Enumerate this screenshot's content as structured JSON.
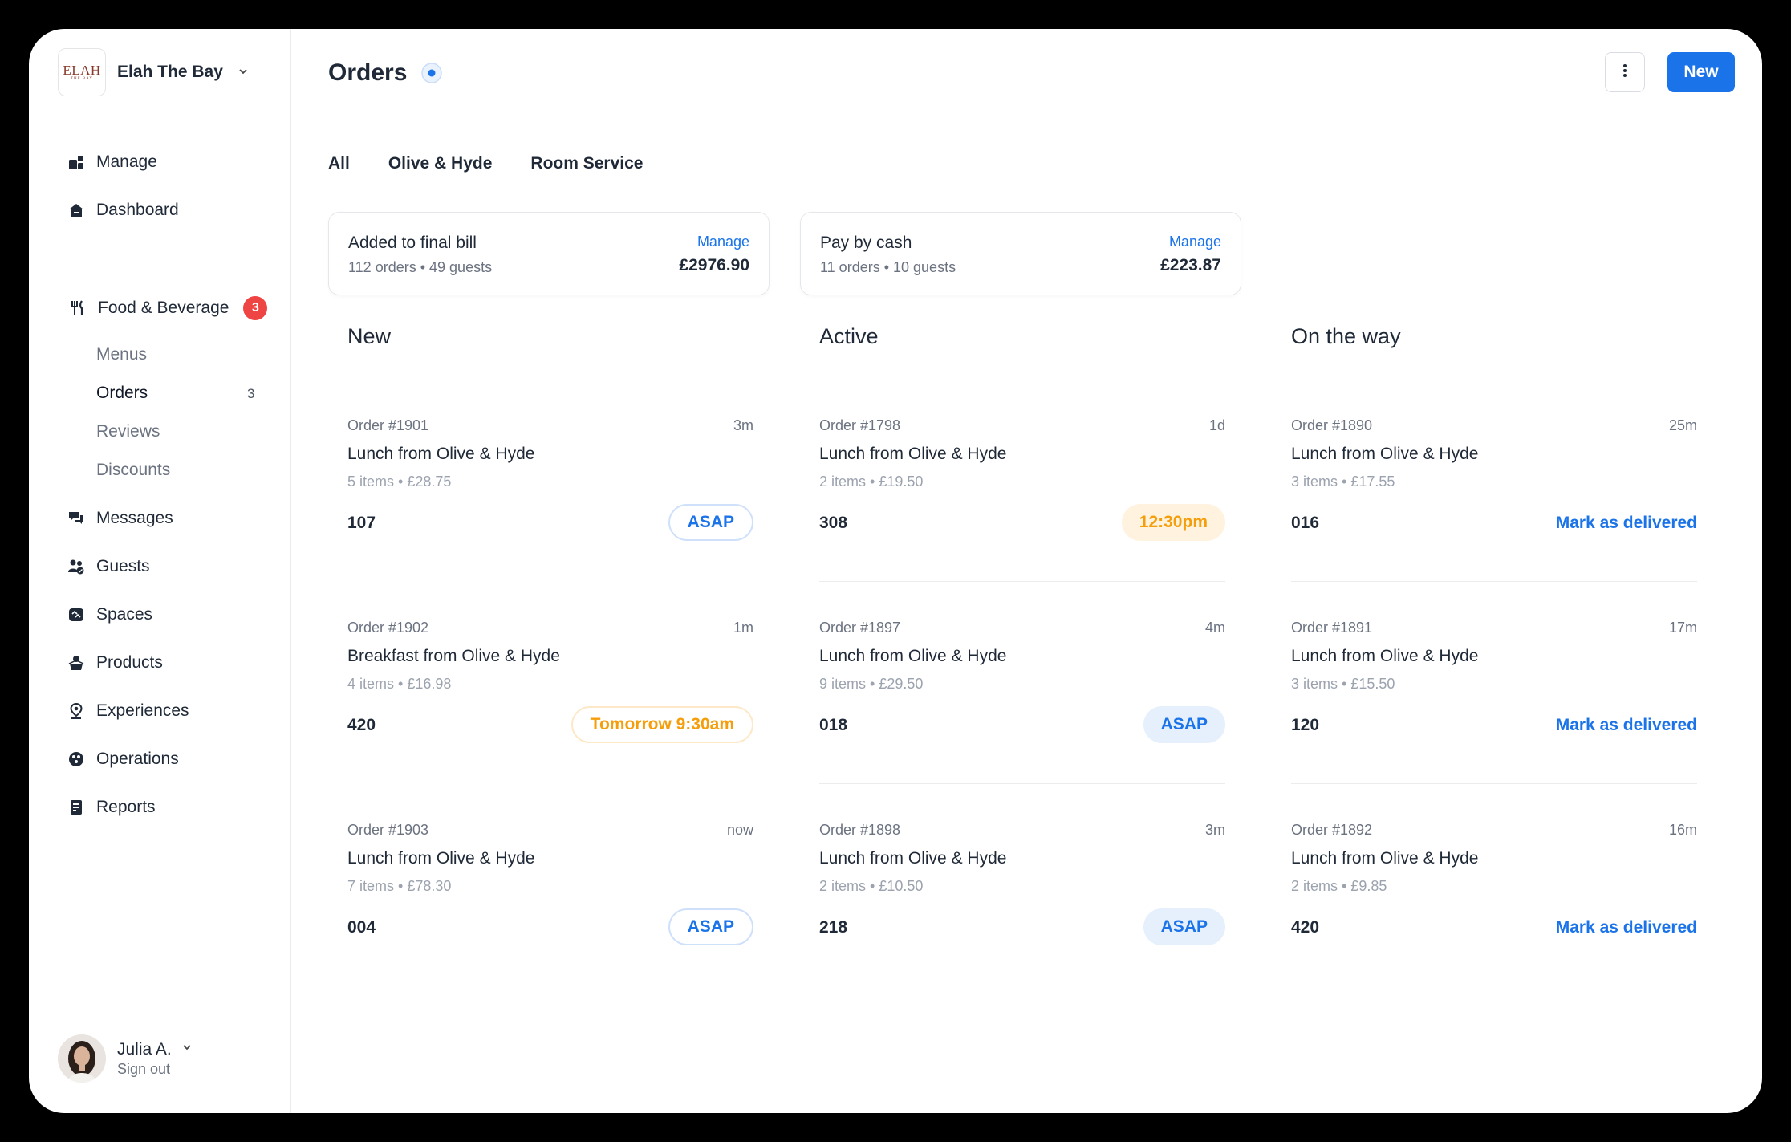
{
  "brand": {
    "logo_line1": "ELAH",
    "logo_line2": "THE BAY",
    "name": "Elah The Bay"
  },
  "sidebar": {
    "main_items": [
      {
        "label": "Manage",
        "icon": "manage-icon"
      },
      {
        "label": "Dashboard",
        "icon": "home-icon"
      }
    ],
    "food_beverage": {
      "label": "Food & Beverage",
      "icon": "fork-knife-icon",
      "badge": "3"
    },
    "sub_items": [
      {
        "label": "Menus"
      },
      {
        "label": "Orders",
        "count": "3",
        "active": true
      },
      {
        "label": "Reviews"
      },
      {
        "label": "Discounts"
      }
    ],
    "items": [
      {
        "label": "Messages",
        "icon": "messages-icon"
      },
      {
        "label": "Guests",
        "icon": "guests-icon"
      },
      {
        "label": "Spaces",
        "icon": "spaces-icon"
      },
      {
        "label": "Products",
        "icon": "products-icon"
      },
      {
        "label": "Experiences",
        "icon": "location-pin-icon"
      },
      {
        "label": "Operations",
        "icon": "operations-icon"
      },
      {
        "label": "Reports",
        "icon": "reports-icon"
      }
    ],
    "user": {
      "name": "Julia A.",
      "sub": "Sign out"
    }
  },
  "header": {
    "title": "Orders",
    "new_label": "New"
  },
  "tabs": [
    "All",
    "Olive & Hyde",
    "Room Service"
  ],
  "stats": [
    {
      "title": "Added to final bill",
      "sub": "112 orders • 49 guests",
      "link": "Manage",
      "amount": "£2976.90"
    },
    {
      "title": "Pay by cash",
      "sub": "11 orders • 10 guests",
      "link": "Manage",
      "amount": "£223.87"
    }
  ],
  "columns": [
    {
      "title": "New",
      "cards": [
        {
          "order": "Order #1901",
          "time": "3m",
          "name": "Lunch from Olive & Hyde",
          "meta": "5 items • £28.75",
          "number": "107",
          "action": "ASAP",
          "style": "outline-blue"
        },
        {
          "order": "Order #1902",
          "time": "1m",
          "name": "Breakfast from Olive & Hyde",
          "meta": "4 items • £16.98",
          "number": "420",
          "action": "Tomorrow 9:30am",
          "style": "outline-orange"
        },
        {
          "order": "Order #1903",
          "time": "now",
          "name": "Lunch from Olive & Hyde",
          "meta": "7 items • £78.30",
          "number": "004",
          "action": "ASAP",
          "style": "outline-blue"
        }
      ]
    },
    {
      "title": "Active",
      "cards": [
        {
          "order": "Order #1798",
          "time": "1d",
          "name": "Lunch from Olive & Hyde",
          "meta": "2 items • £19.50",
          "number": "308",
          "action": "12:30pm",
          "style": "fill-orange"
        },
        {
          "order": "Order #1897",
          "time": "4m",
          "name": "Lunch from Olive & Hyde",
          "meta": "9 items • £29.50",
          "number": "018",
          "action": "ASAP",
          "style": "fill-blue"
        },
        {
          "order": "Order #1898",
          "time": "3m",
          "name": "Lunch from Olive & Hyde",
          "meta": "2 items • £10.50",
          "number": "218",
          "action": "ASAP",
          "style": "fill-blue"
        }
      ]
    },
    {
      "title": "On the way",
      "cards": [
        {
          "order": "Order #1890",
          "time": "25m",
          "name": "Lunch from Olive & Hyde",
          "meta": "3 items • £17.55",
          "number": "016",
          "action": "Mark as delivered",
          "style": "link"
        },
        {
          "order": "Order #1891",
          "time": "17m",
          "name": "Lunch from Olive & Hyde",
          "meta": "3 items • £15.50",
          "number": "120",
          "action": "Mark as delivered",
          "style": "link"
        },
        {
          "order": "Order #1892",
          "time": "16m",
          "name": "Lunch from Olive & Hyde",
          "meta": "2 items • £9.85",
          "number": "420",
          "action": "Mark as delivered",
          "style": "link"
        }
      ]
    }
  ],
  "colors": {
    "accent": "#1a73e8",
    "badge": "#ef4444",
    "orange": "#f59e0b"
  }
}
